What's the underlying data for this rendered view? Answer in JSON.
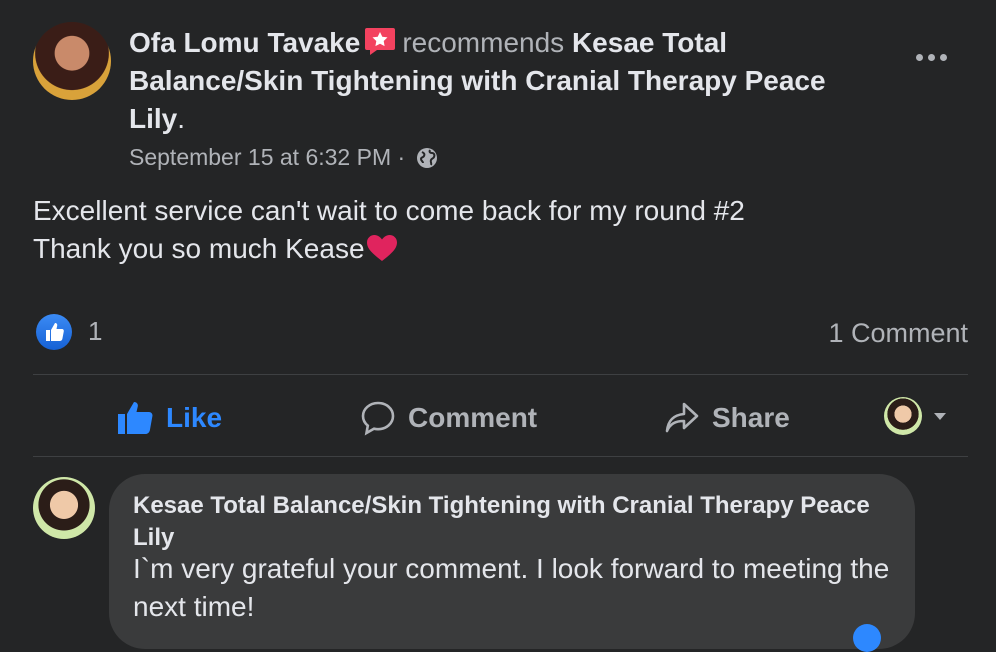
{
  "post": {
    "author": "Ofa Lomu Tavake",
    "recommends_text": "recommends",
    "page_name": "Kesae Total Balance/Skin Tightening with Cranial Therapy Peace Lily",
    "period": ".",
    "timestamp": "September 15 at 6:32 PM",
    "separator": "·",
    "text_line1": "Excellent service can't wait to come back for my round #2",
    "text_line2": "Thank you so much Kease",
    "like_count": "1",
    "comment_count": "1 Comment"
  },
  "actions": {
    "like": "Like",
    "comment": "Comment",
    "share": "Share"
  },
  "comment": {
    "author": "Kesae Total Balance/Skin Tightening with Cranial Therapy Peace Lily",
    "text": "I`m very grateful your comment. I look forward to meeting the next time!"
  },
  "colors": {
    "background": "#242526",
    "accent": "#2d88ff",
    "recommend": "#f3425f",
    "heart": "#e0245e"
  },
  "icons": [
    "recommend-icon",
    "globe-icon",
    "more-icon",
    "heart-icon",
    "like-icon",
    "comment-icon",
    "share-icon",
    "chevron-down-icon"
  ]
}
